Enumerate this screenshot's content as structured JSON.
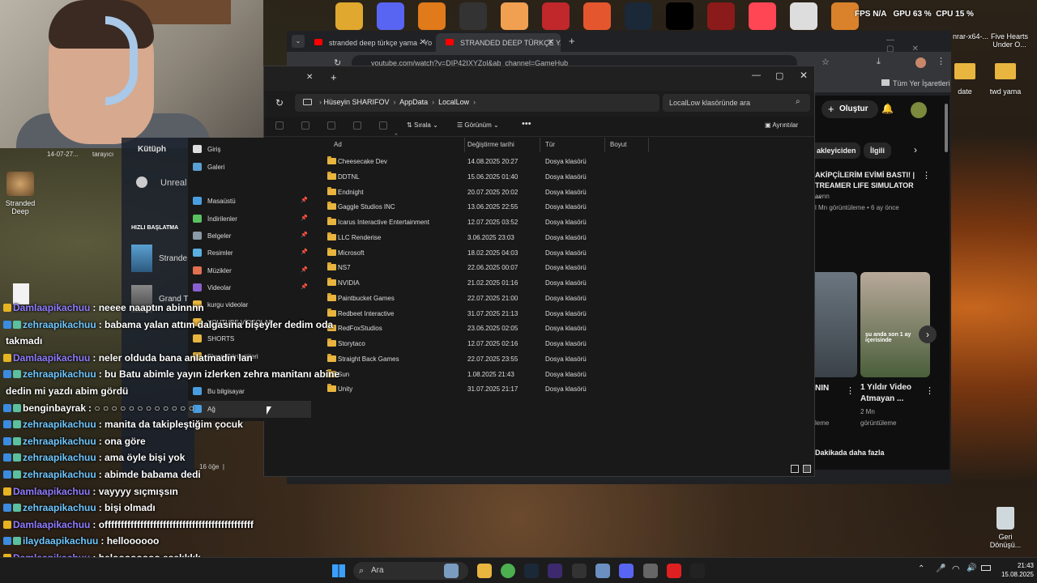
{
  "desktop": {
    "top_icons": [
      "Bandicam",
      "Discord",
      "Counter-Strike 2",
      "OBS Studio",
      "Game",
      "Game",
      "Game",
      "Steam",
      "CapCut",
      "Red Dead",
      "Valorant",
      "Dead",
      "Half-Life"
    ],
    "fps_label": "FPS",
    "fps_value": "N/A",
    "gpu_label": "GPU",
    "gpu_value": "63 %",
    "cpu_label": "CPU",
    "cpu_value": "15 %",
    "right_icons": [
      {
        "label": "Five Hearts Under O..."
      },
      {
        "label": "date"
      },
      {
        "label": "twd yama"
      },
      {
        "label": "nrar-x64-..."
      }
    ],
    "stranded_label": "Stranded Deep",
    "recycle_label": "Geri Dönüşü..."
  },
  "chrome": {
    "tabs": [
      {
        "title": "stranded deep türkçe yama - Yo"
      },
      {
        "title": "STRANDED DEEP TÜRKÇE YAMA"
      }
    ],
    "url": "youtube.com/watch?v=DIP42IXYZol&ab_channel=GameHub",
    "bookmarks_label": "Tüm Yer İşaretleri",
    "create_label": "Oluştur",
    "yt_chips": [
      "akleyiciden",
      "İlgili"
    ],
    "yt_video1": {
      "title": "AKİPÇİLERİM EVİMİ BASTI! | TREAMER LIFE SIMULATOR ...",
      "channel": "aenn",
      "meta": "l Mn görüntüleme • 6 ay önce"
    },
    "yt_video2": {
      "title": "1 Yıldır Video Atmayan ...",
      "views": "2 Mn",
      "views2": "görüntüleme",
      "thumb_text": "şu anda son 1 ay içerisinde"
    },
    "yt_video3": {
      "title": "NIN",
      "meta": "leme"
    },
    "yt_video4": {
      "title": "Dakikada daha fazla"
    }
  },
  "steam": {
    "library": "Kütüph",
    "unreal": "Unreal",
    "quick_start": "HIZLI BAŞLATMA",
    "game1": "Strande",
    "game2": "Grand T",
    "side_label": "tarayıcı",
    "date": "14-07-27..."
  },
  "explorer": {
    "new_tab": "+",
    "breadcrumb": [
      "Hüseyin SHARIFOV",
      "AppData",
      "LocalLow"
    ],
    "search_placeholder": "LocalLow klasöründe ara",
    "sort_label": "Sırala",
    "view_label": "Görünüm",
    "details_label": "Ayrıntılar",
    "nav": [
      {
        "label": "Giriş",
        "pinned": false
      },
      {
        "label": "Galeri",
        "pinned": false
      },
      {
        "label": "Masaüstü",
        "pinned": true
      },
      {
        "label": "İndirilenler",
        "pinned": true
      },
      {
        "label": "Belgeler",
        "pinned": true
      },
      {
        "label": "Resimler",
        "pinned": true
      },
      {
        "label": "Müzikler",
        "pinned": true
      },
      {
        "label": "Videolar",
        "pinned": true
      },
      {
        "label": "kurgu videolar",
        "pinned": false
      },
      {
        "label": "YOUTUBE VİDEOLAR",
        "pinned": false
      },
      {
        "label": "SHORTS",
        "pinned": false
      },
      {
        "label": "Ekran Görüntüleri",
        "pinned": false
      },
      {
        "label": "Bu bilgisayar",
        "pinned": false
      },
      {
        "label": "Ağ",
        "pinned": false
      }
    ],
    "columns": [
      "Ad",
      "Değiştirme tarihi",
      "Tür",
      "Boyut"
    ],
    "rows": [
      {
        "name": "Cheesecake Dev",
        "date": "14.08.2025 20:27",
        "type": "Dosya klasörü"
      },
      {
        "name": "DDTNL",
        "date": "15.06.2025 01:40",
        "type": "Dosya klasörü"
      },
      {
        "name": "Endnight",
        "date": "20.07.2025 20:02",
        "type": "Dosya klasörü"
      },
      {
        "name": "Gaggle Studios INC",
        "date": "13.06.2025 22:55",
        "type": "Dosya klasörü"
      },
      {
        "name": "Icarus Interactive Entertainment",
        "date": "12.07.2025 03:52",
        "type": "Dosya klasörü"
      },
      {
        "name": "LLC Renderise",
        "date": "3.06.2025 23:03",
        "type": "Dosya klasörü"
      },
      {
        "name": "Microsoft",
        "date": "18.02.2025 04:03",
        "type": "Dosya klasörü"
      },
      {
        "name": "NS7",
        "date": "22.06.2025 00:07",
        "type": "Dosya klasörü"
      },
      {
        "name": "NVIDIA",
        "date": "21.02.2025 01:16",
        "type": "Dosya klasörü"
      },
      {
        "name": "Paintbucket Games",
        "date": "22.07.2025 21:00",
        "type": "Dosya klasörü"
      },
      {
        "name": "Redbeet Interactive",
        "date": "31.07.2025 21:13",
        "type": "Dosya klasörü"
      },
      {
        "name": "RedFoxStudios",
        "date": "23.06.2025 02:05",
        "type": "Dosya klasörü"
      },
      {
        "name": "Storytaco",
        "date": "12.07.2025 02:16",
        "type": "Dosya klasörü"
      },
      {
        "name": "Straight Back Games",
        "date": "22.07.2025 23:55",
        "type": "Dosya klasörü"
      },
      {
        "name": "Sun",
        "date": "1.08.2025 21:43",
        "type": "Dosya klasörü"
      },
      {
        "name": "Unity",
        "date": "31.07.2025 21:17",
        "type": "Dosya klasörü"
      }
    ],
    "status": "16 öğe"
  },
  "chat": [
    {
      "user": "Damlaapikachuu",
      "msg": ": neeee naaptın abinnnn",
      "c": "u1"
    },
    {
      "user": "zehraapikachuu",
      "msg": ": babama yalan attım dalgasına bişeyler dedim oda",
      "c": "u2"
    },
    {
      "user": "",
      "msg": "takmadı",
      "c": "u2"
    },
    {
      "user": "Damlaapikachuu",
      "msg": ": neler olduda bana anlatmadın lan",
      "c": "u1"
    },
    {
      "user": "zehraapikachuu",
      "msg": ": bu Batu abimle yayın izlerken zehra manitanı abine",
      "c": "u2"
    },
    {
      "user": "",
      "msg": "dedin mi yazdı abim gördü",
      "c": "u2"
    },
    {
      "user": "benginbayrak",
      "msg": ": ○ ○ ○ ○ ○ ○ ○ ○ ○ ○ ○ ○",
      "c": "u0"
    },
    {
      "user": "zehraapikachuu",
      "msg": ": manita da takipleştiğim çocuk",
      "c": "u2"
    },
    {
      "user": "zehraapikachuu",
      "msg": ": ona göre",
      "c": "u2"
    },
    {
      "user": "zehraapikachuu",
      "msg": ": ama öyle bişi yok",
      "c": "u2"
    },
    {
      "user": "zehraapikachuu",
      "msg": ": abimde babama dedi",
      "c": "u2"
    },
    {
      "user": "Damlaapikachuu",
      "msg": ": vayyyy sıçmışsın",
      "c": "u1"
    },
    {
      "user": "zehraapikachuu",
      "msg": ": bişi olmadı",
      "c": "u2"
    },
    {
      "user": "Damlaapikachuu",
      "msg": ": offffffffffffffffffffffffffffffffffffffffffffff",
      "c": "u1"
    },
    {
      "user": "ilaydaapikachuu",
      "msg": ": helloooooo",
      "c": "u2"
    },
    {
      "user": "Damlaapikachuu",
      "msg": ": heloooooooo esekkkk",
      "c": "u1"
    }
  ],
  "taskbar": {
    "search": "Ara",
    "time": "21:43",
    "date": "15.08.2025"
  }
}
